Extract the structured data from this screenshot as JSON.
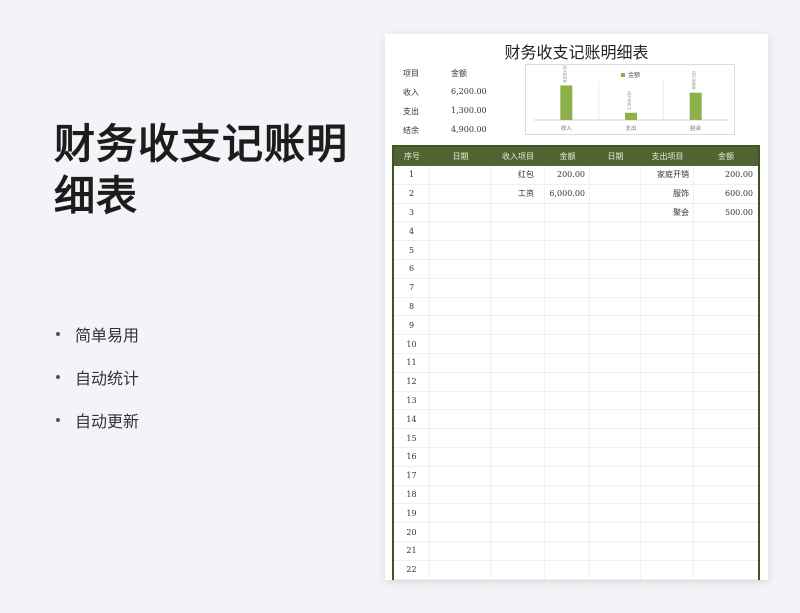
{
  "promo": {
    "title": "财务收支记账明细表",
    "features": [
      "简单易用",
      "自动统计",
      "自动更新"
    ]
  },
  "sheet": {
    "title": "财务收支记账明细表",
    "summary": {
      "header": {
        "item": "项目",
        "amount": "金额"
      },
      "rows": [
        {
          "item": "收入",
          "amount": "6,200.00"
        },
        {
          "item": "支出",
          "amount": "1,300.00"
        },
        {
          "item": "结余",
          "amount": "4,900.00"
        }
      ]
    },
    "table": {
      "headers": [
        "序号",
        "日期",
        "收入项目",
        "金额",
        "日期",
        "支出项目",
        "金额"
      ],
      "rows": [
        [
          "1",
          "",
          "红包",
          "200.00",
          "",
          "家庭开销",
          "200.00"
        ],
        [
          "2",
          "",
          "工资",
          "6,000.00",
          "",
          "服饰",
          "600.00"
        ],
        [
          "3",
          "",
          "",
          "",
          "",
          "聚会",
          "500.00"
        ],
        [
          "4",
          "",
          "",
          "",
          "",
          "",
          ""
        ],
        [
          "5",
          "",
          "",
          "",
          "",
          "",
          ""
        ],
        [
          "6",
          "",
          "",
          "",
          "",
          "",
          ""
        ],
        [
          "7",
          "",
          "",
          "",
          "",
          "",
          ""
        ],
        [
          "8",
          "",
          "",
          "",
          "",
          "",
          ""
        ],
        [
          "9",
          "",
          "",
          "",
          "",
          "",
          ""
        ],
        [
          "10",
          "",
          "",
          "",
          "",
          "",
          ""
        ],
        [
          "11",
          "",
          "",
          "",
          "",
          "",
          ""
        ],
        [
          "12",
          "",
          "",
          "",
          "",
          "",
          ""
        ],
        [
          "13",
          "",
          "",
          "",
          "",
          "",
          ""
        ],
        [
          "14",
          "",
          "",
          "",
          "",
          "",
          ""
        ],
        [
          "15",
          "",
          "",
          "",
          "",
          "",
          ""
        ],
        [
          "16",
          "",
          "",
          "",
          "",
          "",
          ""
        ],
        [
          "17",
          "",
          "",
          "",
          "",
          "",
          ""
        ],
        [
          "18",
          "",
          "",
          "",
          "",
          "",
          ""
        ],
        [
          "19",
          "",
          "",
          "",
          "",
          "",
          ""
        ],
        [
          "20",
          "",
          "",
          "",
          "",
          "",
          ""
        ],
        [
          "21",
          "",
          "",
          "",
          "",
          "",
          ""
        ],
        [
          "22",
          "",
          "",
          "",
          "",
          "",
          ""
        ]
      ]
    }
  },
  "colors": {
    "header_bg": "#4e6431",
    "bar": "#8db04a"
  },
  "chart_data": {
    "type": "bar",
    "categories": [
      "收入",
      "支出",
      "结余"
    ],
    "series": [
      {
        "name": "金额",
        "values": [
          6200,
          1300,
          4900
        ]
      }
    ],
    "data_labels": [
      "6200.00",
      "1300.00",
      "4900.00"
    ],
    "legend": "top",
    "ylim": [
      0,
      7000
    ]
  }
}
